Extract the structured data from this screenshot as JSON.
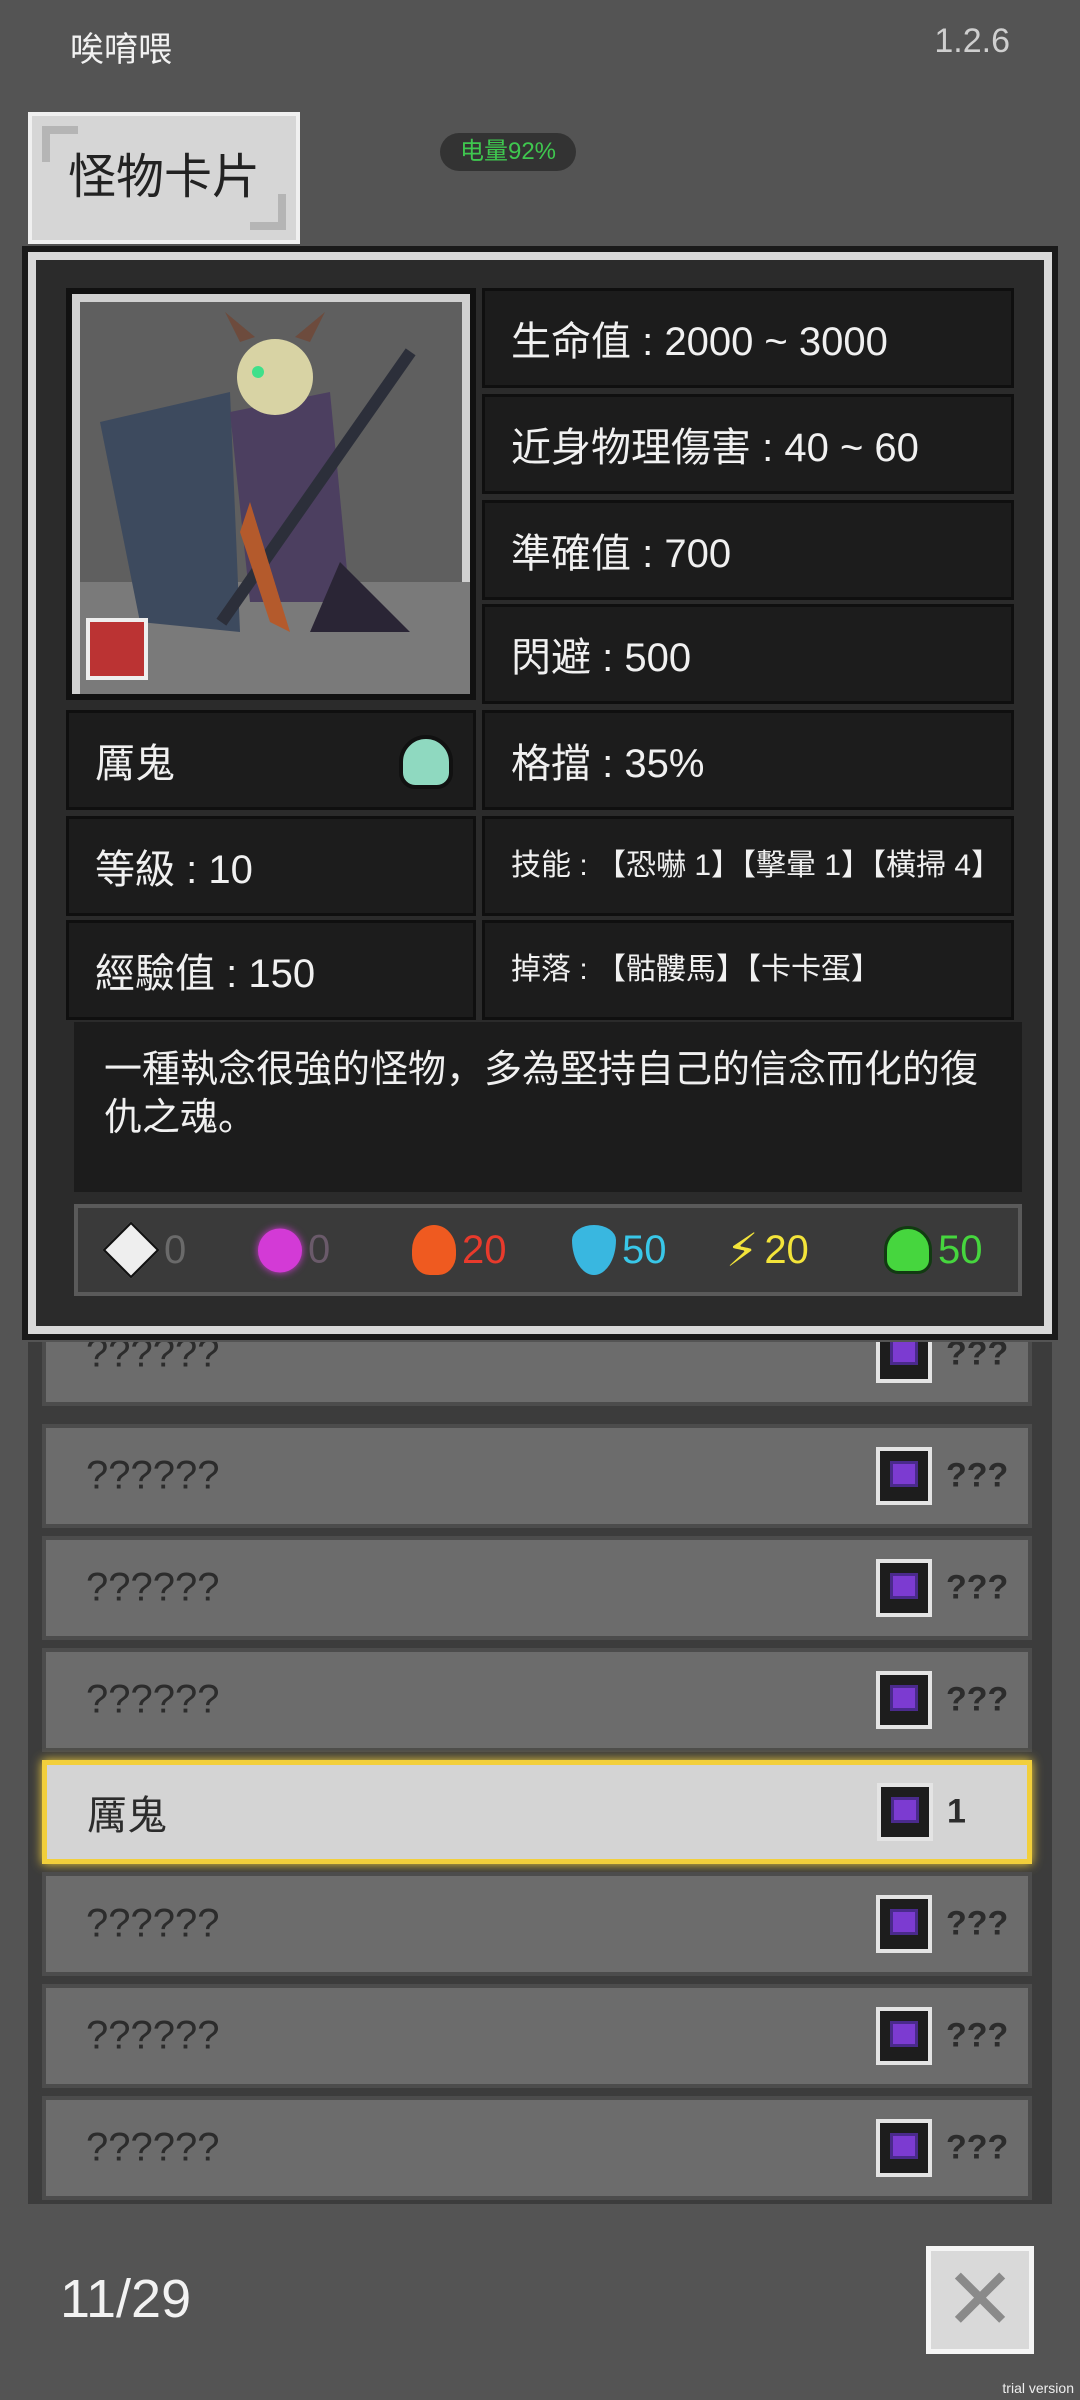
{
  "status": {
    "app_title": "唉唷喂",
    "version": "1.2.6",
    "battery": "电量92%"
  },
  "tab": {
    "label": "怪物卡片"
  },
  "monster": {
    "name": "厲鬼",
    "hp": "生命值 : 2000 ~ 3000",
    "melee": "近身物理傷害 : 40 ~ 60",
    "accuracy": "準確值 : 700",
    "evasion": "閃避 : 500",
    "block": "格擋 : 35%",
    "level": "等級 : 10",
    "skills": "技能 : 【恐嚇 1】【擊暈 1】【橫掃 4】",
    "exp": "經驗值 : 150",
    "drops": "掉落 : 【骷髏馬】【卡卡蛋】",
    "description": "一種執念很強的怪物，多為堅持自己的信念而化的復仇之魂。"
  },
  "resistances": [
    {
      "icon": "physical-icon",
      "value": "0",
      "color": "#6a6a6a"
    },
    {
      "icon": "magic-icon",
      "value": "0",
      "color": "#6a5a6a"
    },
    {
      "icon": "fire-icon",
      "value": "20",
      "color": "#e83a2c"
    },
    {
      "icon": "water-icon",
      "value": "50",
      "color": "#39c7e8"
    },
    {
      "icon": "lightning-icon",
      "value": "20",
      "color": "#f3e43a"
    },
    {
      "icon": "poison-icon",
      "value": "50",
      "color": "#46d63e"
    }
  ],
  "list": [
    {
      "name": "??????",
      "count": "???"
    },
    {
      "name": "??????",
      "count": "???"
    },
    {
      "name": "??????",
      "count": "???"
    },
    {
      "name": "??????",
      "count": "???"
    },
    {
      "name": "厲鬼",
      "count": "1",
      "selected": true
    },
    {
      "name": "??????",
      "count": "???"
    },
    {
      "name": "??????",
      "count": "???"
    },
    {
      "name": "??????",
      "count": "???"
    }
  ],
  "footer": {
    "page": "11/29",
    "watermark": "trial version"
  }
}
